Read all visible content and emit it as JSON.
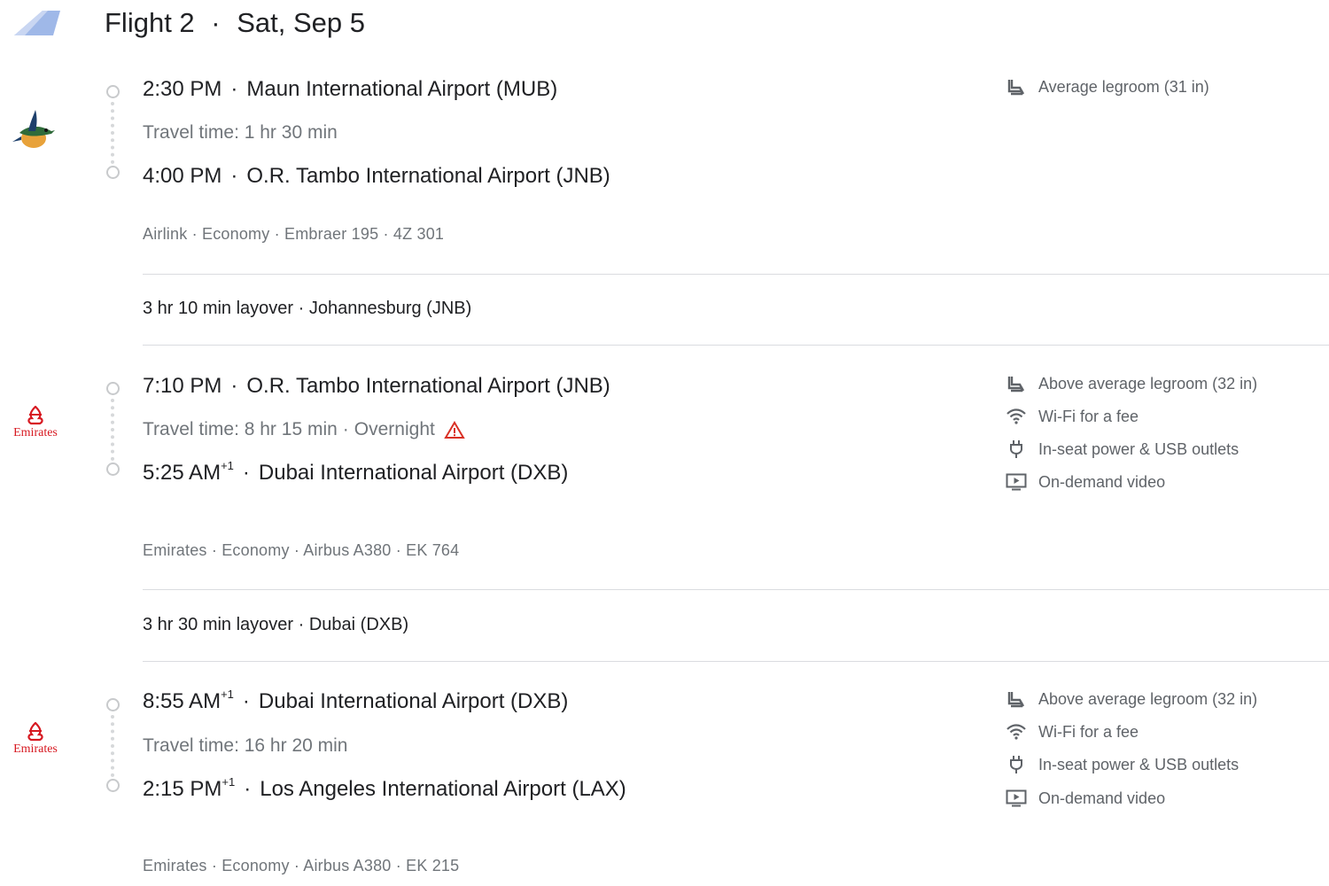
{
  "header": {
    "title": "Flight 2",
    "date": "Sat, Sep 5"
  },
  "segments": [
    {
      "depart_time": "2:30 PM",
      "depart_sup": "",
      "depart_airport": "Maun International Airport (MUB)",
      "travel_time": "Travel time: 1 hr 30 min",
      "overnight": "",
      "arrive_time": "4:00 PM",
      "arrive_sup": "",
      "arrive_airport": "O.R. Tambo International Airport (JNB)",
      "meta": "Airlink · Economy · Embraer 195 · 4Z 301",
      "amenities": [
        "Average legroom (31 in)"
      ],
      "logo": "bird-logo"
    },
    {
      "depart_time": "7:10 PM",
      "depart_sup": "",
      "depart_airport": "O.R. Tambo International Airport (JNB)",
      "travel_time": "Travel time: 8 hr 15 min",
      "overnight": "Overnight",
      "arrive_time": "5:25 AM",
      "arrive_sup": "+1",
      "arrive_airport": "Dubai International Airport (DXB)",
      "meta": "Emirates · Economy · Airbus A380 · EK 764",
      "amenities": [
        "Above average legroom (32 in)",
        "Wi-Fi for a fee",
        "In-seat power & USB outlets",
        "On-demand video"
      ],
      "logo_text": "Emirates"
    },
    {
      "depart_time": "8:55 AM",
      "depart_sup": "+1",
      "depart_airport": "Dubai International Airport (DXB)",
      "travel_time": "Travel time: 16 hr 20 min",
      "overnight": "",
      "arrive_time": "2:15 PM",
      "arrive_sup": "+1",
      "arrive_airport": "Los Angeles International Airport (LAX)",
      "meta": "Emirates · Economy · Airbus A380 · EK 215",
      "amenities": [
        "Above average legroom (32 in)",
        "Wi-Fi for a fee",
        "In-seat power & USB outlets",
        "On-demand video"
      ],
      "logo_text": "Emirates"
    }
  ],
  "layovers": [
    "3 hr 10 min layover · Johannesburg (JNB)",
    "3 hr 30 min layover · Dubai (DXB)"
  ],
  "colors": {
    "warning": "#d93025",
    "text": "#202124",
    "muted": "#70757a",
    "emirates_red": "#d71921"
  }
}
